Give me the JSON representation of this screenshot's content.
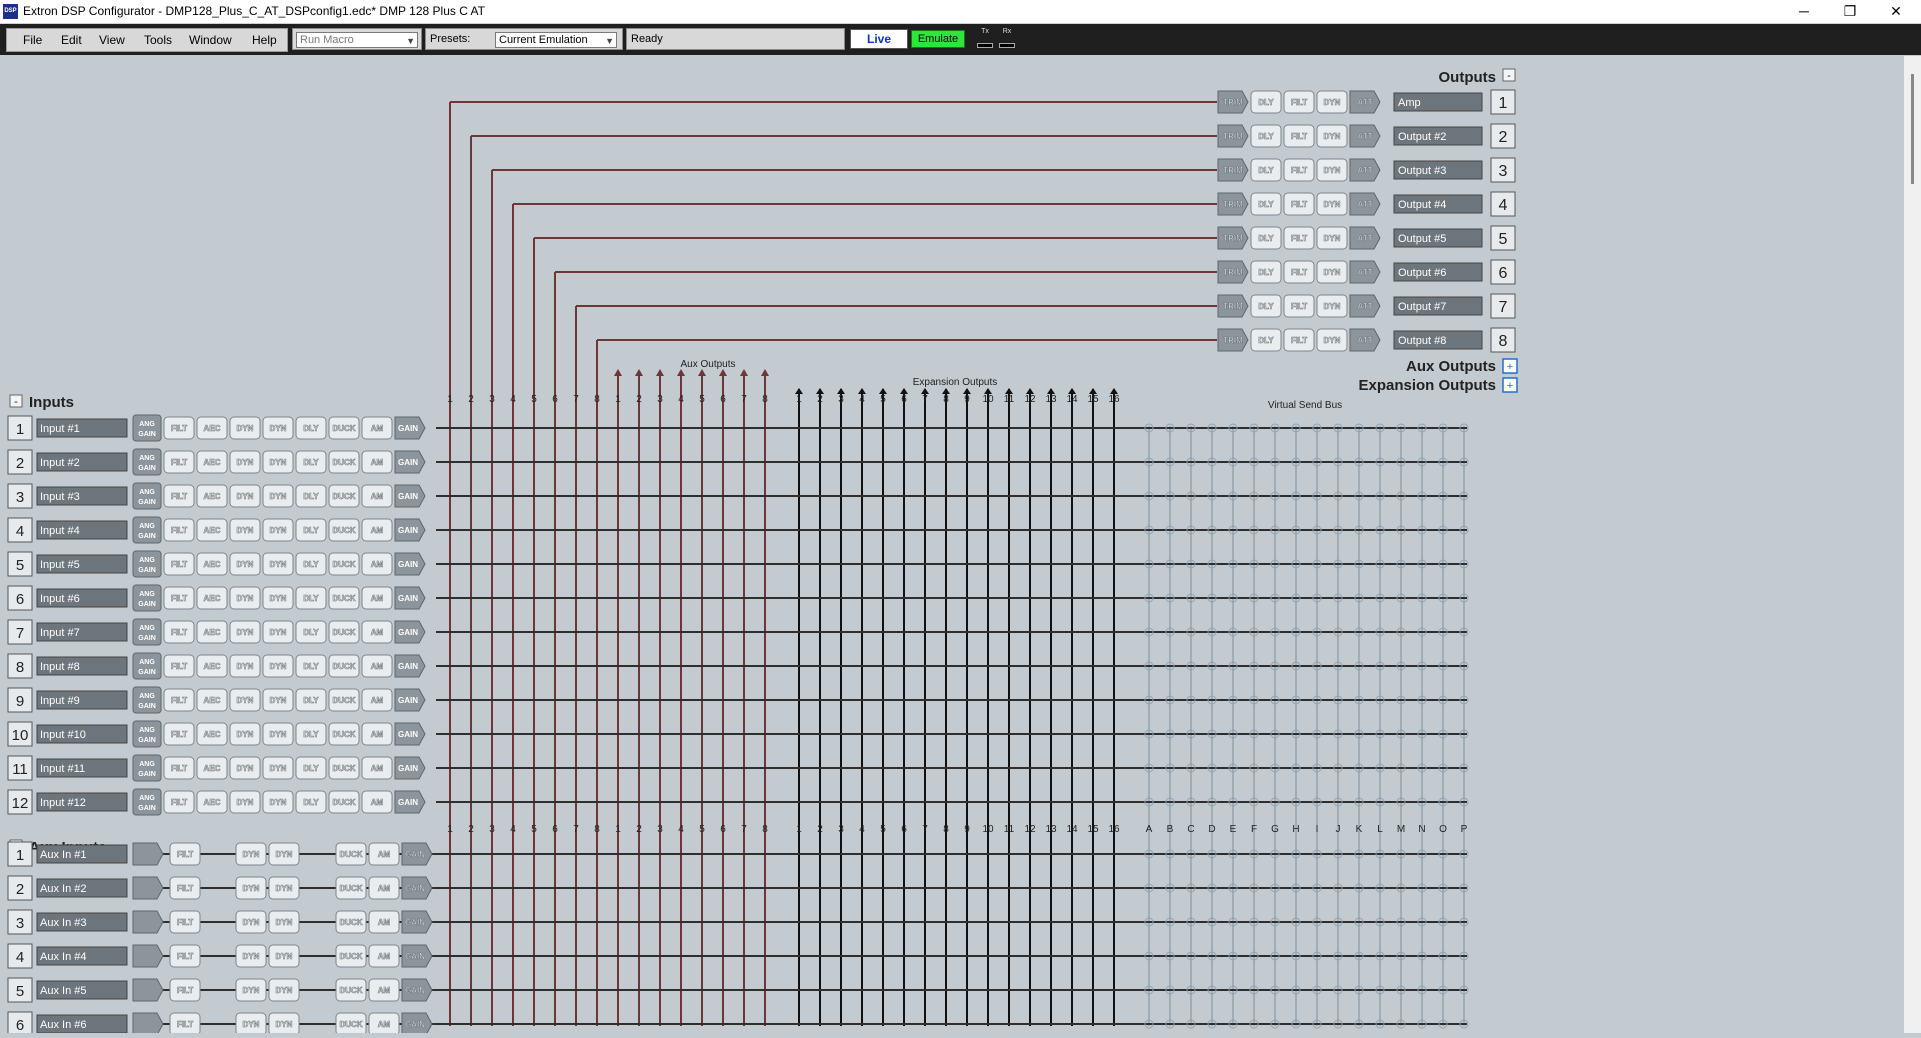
{
  "window": {
    "title": "Extron DSP Configurator - DMP128_Plus_C_AT_DSPconfig1.edc*  DMP 128 Plus C AT",
    "icon_text": "DSP",
    "controls": {
      "minimize": "─",
      "maximize": "❐",
      "close": "✕"
    }
  },
  "toolbar": {
    "menus": [
      "File",
      "Edit",
      "View",
      "Tools",
      "Window",
      "Help"
    ],
    "macro_placeholder": "Run Macro",
    "presets_label": "Presets:",
    "preset_value": "Current Emulation",
    "status": "Ready",
    "live_label": "Live",
    "emulate_label": "Emulate",
    "tx_label": "Tx",
    "rx_label": "Rx"
  },
  "colors": {
    "background": "#c3cbd0",
    "output_line": "#6e3636",
    "matrix_line": "#2e2e2e",
    "node": "#8fa3b3",
    "emulate": "#2ee63a",
    "live_text": "#0a33cc"
  },
  "outputs": {
    "header": "Outputs",
    "collapse": "-",
    "blocks": [
      "TRIM",
      "DLY",
      "FILT",
      "DYN",
      "ATT"
    ],
    "items": [
      {
        "num": "1",
        "name": "Amp"
      },
      {
        "num": "2",
        "name": "Output #2"
      },
      {
        "num": "3",
        "name": "Output #3"
      },
      {
        "num": "4",
        "name": "Output #4"
      },
      {
        "num": "5",
        "name": "Output #5"
      },
      {
        "num": "6",
        "name": "Output #6"
      },
      {
        "num": "7",
        "name": "Output #7"
      },
      {
        "num": "8",
        "name": "Output #8"
      }
    ]
  },
  "aux_outputs": {
    "label": "Aux Outputs",
    "expand": "+"
  },
  "expansion_outputs": {
    "label": "Expansion Outputs",
    "expand": "+"
  },
  "bus_labels": {
    "aux_outputs": "Aux Outputs",
    "expansion_outputs": "Expansion Outputs",
    "virtual_send_bus": "Virtual Send Bus"
  },
  "columns": {
    "outputs": [
      "1",
      "2",
      "3",
      "4",
      "5",
      "6",
      "7",
      "8"
    ],
    "aux": [
      "1",
      "2",
      "3",
      "4",
      "5",
      "6",
      "7",
      "8"
    ],
    "expansion": [
      "1",
      "2",
      "3",
      "4",
      "5",
      "6",
      "7",
      "8",
      "9",
      "10",
      "11",
      "12",
      "13",
      "14",
      "15",
      "16"
    ],
    "virtual": [
      "A",
      "B",
      "C",
      "D",
      "E",
      "F",
      "G",
      "H",
      "I",
      "J",
      "K",
      "L",
      "M",
      "N",
      "O",
      "P"
    ]
  },
  "inputs": {
    "header": "Inputs",
    "collapse": "-",
    "blocks": [
      "ANG GAIN",
      "FILT",
      "AEC",
      "DYN",
      "DYN",
      "DLY",
      "DUCK",
      "AM",
      "GAIN"
    ],
    "items": [
      {
        "num": "1",
        "name": "Input #1"
      },
      {
        "num": "2",
        "name": "Input #2"
      },
      {
        "num": "3",
        "name": "Input #3"
      },
      {
        "num": "4",
        "name": "Input #4"
      },
      {
        "num": "5",
        "name": "Input #5"
      },
      {
        "num": "6",
        "name": "Input #6"
      },
      {
        "num": "7",
        "name": "Input #7"
      },
      {
        "num": "8",
        "name": "Input #8"
      },
      {
        "num": "9",
        "name": "Input #9"
      },
      {
        "num": "10",
        "name": "Input #10"
      },
      {
        "num": "11",
        "name": "Input #11"
      },
      {
        "num": "12",
        "name": "Input #12"
      }
    ]
  },
  "aux_inputs": {
    "header": "Aux Inputs",
    "collapse": "-",
    "blocks": [
      "",
      "FILT",
      "DYN",
      "DYN",
      "DUCK",
      "AM",
      "GAIN"
    ],
    "items": [
      {
        "num": "1",
        "name": "Aux In #1"
      },
      {
        "num": "2",
        "name": "Aux In #2"
      },
      {
        "num": "3",
        "name": "Aux In #3"
      },
      {
        "num": "4",
        "name": "Aux In #4"
      },
      {
        "num": "5",
        "name": "Aux In #5"
      },
      {
        "num": "6",
        "name": "Aux In #6"
      }
    ]
  }
}
